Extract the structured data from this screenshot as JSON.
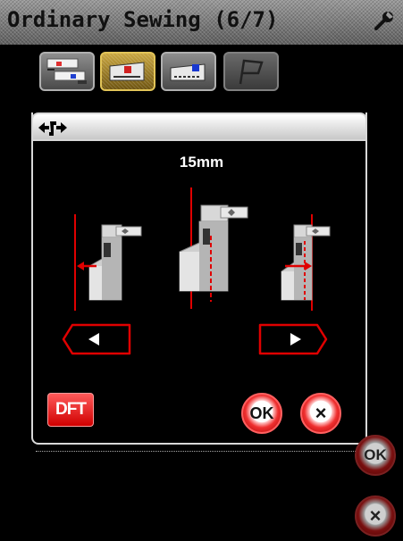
{
  "title": "Ordinary Sewing (6/7)",
  "tabs": [
    {
      "name": "mode-tab-1",
      "state": "normal"
    },
    {
      "name": "mode-tab-2",
      "state": "selected"
    },
    {
      "name": "mode-tab-3",
      "state": "normal"
    },
    {
      "name": "mode-tab-4",
      "state": "disabled"
    }
  ],
  "dialog": {
    "header_icon": "foot-position-arrows-icon",
    "value": "15mm"
  },
  "buttons": {
    "left": "left-arrow-icon",
    "right": "right-arrow-icon",
    "dft": "DFT",
    "ok": "OK",
    "cancel": "×"
  },
  "colors": {
    "accent_red": "#e00000",
    "active_tab": "#c9a640"
  }
}
